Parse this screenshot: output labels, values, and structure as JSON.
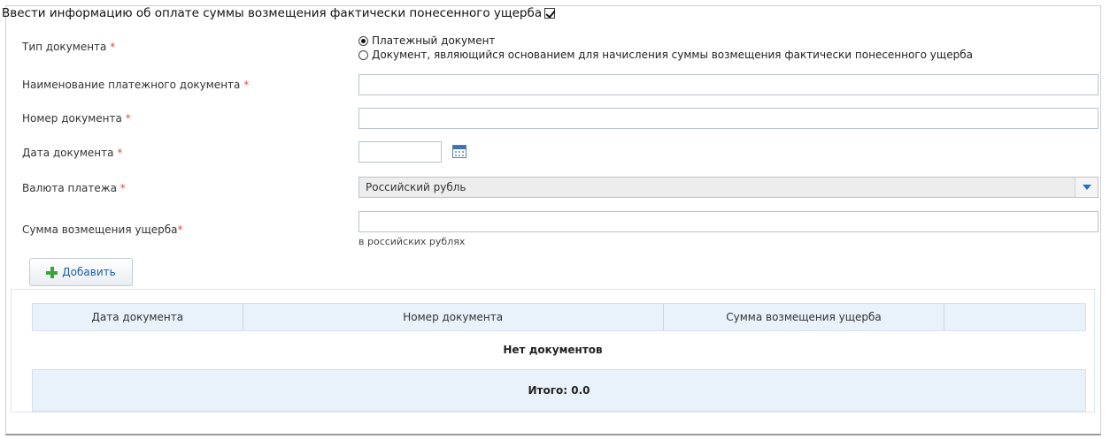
{
  "header": {
    "title": "Ввести информацию об оплате суммы возмещения фактически понесенного ущерба",
    "checked": true
  },
  "form": {
    "doc_type_label": "Тип документа",
    "doc_type_options": [
      "Платежный документ",
      "Документ, являющийся основанием для начисления суммы возмещения фактически понесенного ущерба"
    ],
    "doc_type_selected": 0,
    "payment_doc_name_label": "Наименование платежного документа",
    "payment_doc_name_value": "",
    "doc_number_label": "Номер документа",
    "doc_number_value": "",
    "doc_date_label": "Дата документа",
    "doc_date_value": "",
    "currency_label": "Валюта платежа",
    "currency_value": "Российский рубль",
    "amount_label": "Сумма возмещения ущерба",
    "amount_value": "",
    "amount_hint": "в российских рублях",
    "required_mark": "*",
    "add_button_label": "Добавить"
  },
  "table": {
    "columns": [
      "Дата документа",
      "Номер документа",
      "Сумма возмещения ущерба",
      ""
    ],
    "empty_text": "Нет документов",
    "total_text": "Итого: 0.0"
  },
  "colors": {
    "required": "#d9534f",
    "link": "#1b5fa8",
    "accent": "#1b73c8",
    "add_icon": "#3aa33a"
  },
  "icons": [
    "checkbox-checked-icon",
    "radio-selected-icon",
    "radio-unselected-icon",
    "calendar-icon",
    "dropdown-arrow-icon",
    "plus-icon"
  ]
}
